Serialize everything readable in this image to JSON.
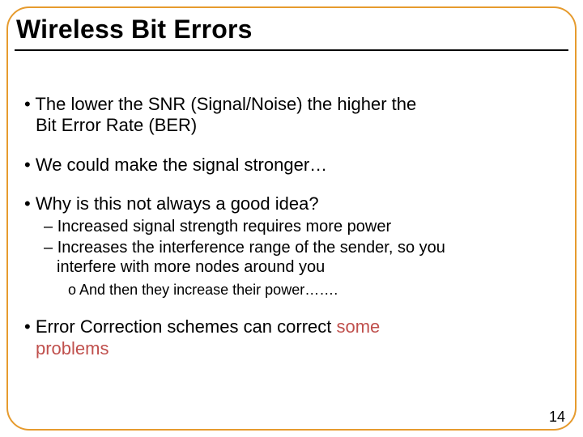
{
  "title": "Wireless Bit Errors",
  "bullets": {
    "p1a": "The lower the SNR (Signal/Noise) the higher the",
    "p1b": "Bit Error Rate (BER)",
    "p2": "We could make the signal stronger…",
    "p3": "Why is this not always a good idea?",
    "p3s1": "Increased signal strength requires more power",
    "p3s2a": "Increases the interference range of the sender, so you",
    "p3s2b": "interfere with more nodes around you",
    "p3s2i": "And then they increase their power…….",
    "p4a_pre": "Error Correction schemes can correct ",
    "p4a_red": "some",
    "p4b_red": "problems"
  },
  "page_number": "14"
}
